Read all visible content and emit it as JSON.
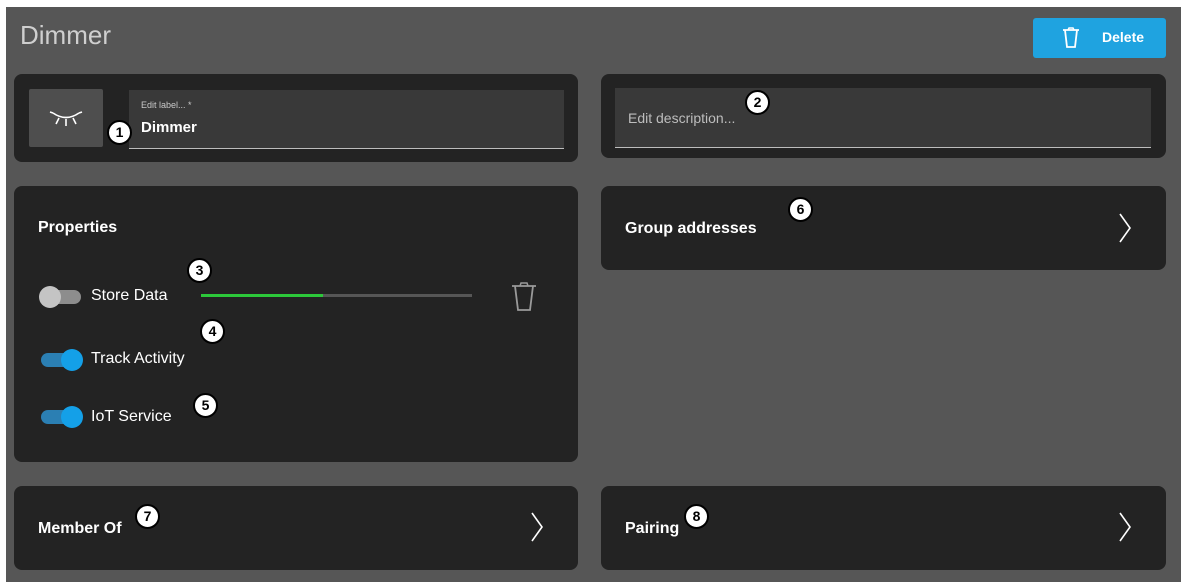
{
  "header": {
    "title": "Dimmer",
    "delete_label": "Delete"
  },
  "label_field": {
    "label": "Edit label... *",
    "value": "Dimmer"
  },
  "description_field": {
    "placeholder": "Edit description..."
  },
  "properties": {
    "title": "Properties",
    "store_data": {
      "label": "Store Data",
      "enabled": false,
      "progress": 0.45
    },
    "track_activity": {
      "label": "Track Activity",
      "enabled": true
    },
    "iot_service": {
      "label": "IoT Service",
      "enabled": true
    }
  },
  "group_addresses": {
    "label": "Group addresses"
  },
  "member_of": {
    "label": "Member Of"
  },
  "pairing": {
    "label": "Pairing"
  },
  "badges": [
    "1",
    "2",
    "3",
    "4",
    "5",
    "6",
    "7",
    "8"
  ],
  "colors": {
    "accent": "#1fa3e0",
    "progress": "#2cc83a",
    "toggle_on": "#14a0e8"
  }
}
